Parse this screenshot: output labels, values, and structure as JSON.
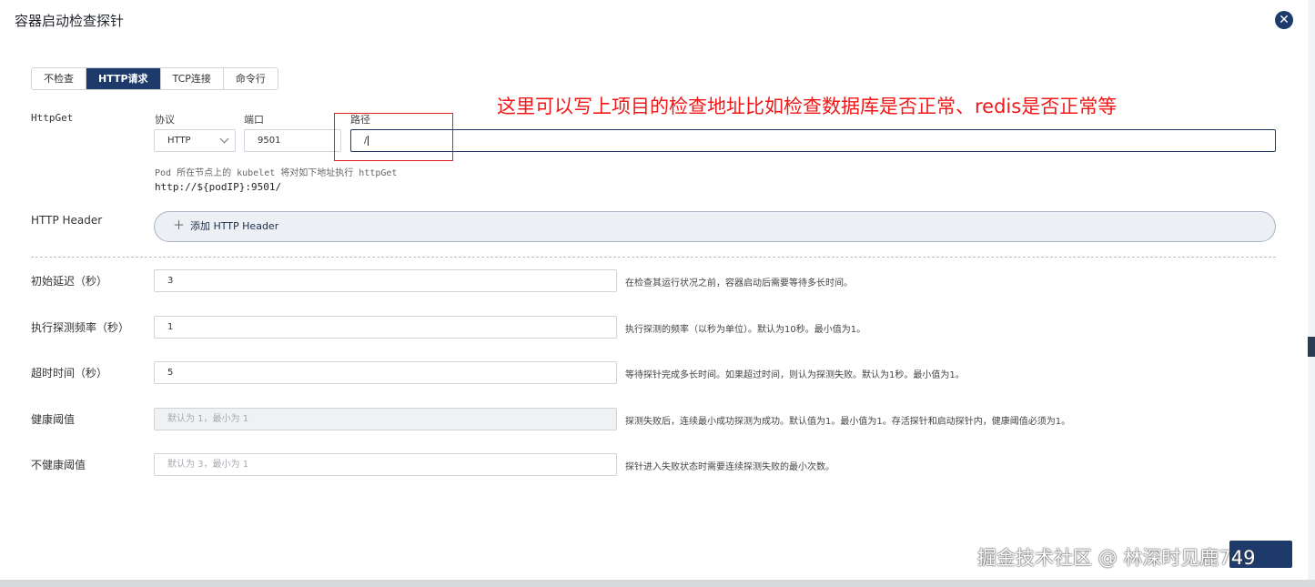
{
  "modal": {
    "title": "容器启动检查探针",
    "close_icon": "close-icon"
  },
  "tabs": [
    {
      "label": "不检查",
      "active": false
    },
    {
      "label": "HTTP请求",
      "active": true
    },
    {
      "label": "TCP连接",
      "active": false
    },
    {
      "label": "命令行",
      "active": false
    }
  ],
  "httpget": {
    "label": "HttpGet",
    "protocol_label": "协议",
    "protocol_value": "HTTP",
    "port_label": "端口",
    "port_value": "9501",
    "path_label": "路径",
    "path_value": "/",
    "hint": "Pod 所在节点上的 kubelet 将对如下地址执行 httpGet",
    "url": "http://${podIP}:9501/"
  },
  "http_header": {
    "label": "HTTP Header",
    "add_button": "添加 HTTP Header"
  },
  "settings": [
    {
      "label": "初始延迟（秒）",
      "value": "3",
      "placeholder": "",
      "disabled": false,
      "desc": "在检查其运行状况之前，容器启动后需要等待多长时间。"
    },
    {
      "label": "执行探测频率（秒）",
      "value": "1",
      "placeholder": "",
      "disabled": false,
      "desc": "执行探测的频率（以秒为单位）。默认为10秒。最小值为1。"
    },
    {
      "label": "超时时间（秒）",
      "value": "5",
      "placeholder": "",
      "disabled": false,
      "desc": "等待探针完成多长时间。如果超过时间，则认为探测失败。默认为1秒。最小值为1。"
    },
    {
      "label": "健康阈值",
      "value": "",
      "placeholder": "默认为 1，最小为 1",
      "disabled": true,
      "desc": "探测失败后，连续最小成功探测为成功。默认值为1。最小值为1。存活探针和启动探针内，健康阈值必须为1。"
    },
    {
      "label": "不健康阈值",
      "value": "",
      "placeholder": "默认为 3，最小为 1",
      "disabled": false,
      "desc": "探针进入失败状态时需要连续探测失败的最小次数。"
    }
  ],
  "annotation": "这里可以写上项目的检查地址比如检查数据库是否正常、redis是否正常等",
  "watermark": "掘金技术社区 @ 林深时见鹿749",
  "colors": {
    "primary": "#1d3a6b",
    "annotation": "#f01818"
  }
}
